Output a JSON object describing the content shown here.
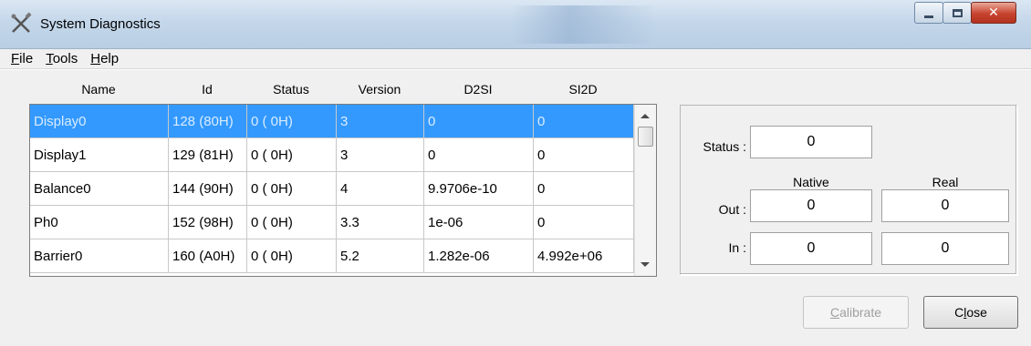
{
  "window": {
    "title": "System Diagnostics",
    "app_icon": "crossed-tools-icon",
    "controls": [
      "minimize-icon",
      "maximize-icon",
      "close-icon"
    ]
  },
  "menu": [
    {
      "pre": "",
      "u": "F",
      "post": "ile"
    },
    {
      "pre": "",
      "u": "T",
      "post": "ools"
    },
    {
      "pre": "",
      "u": "H",
      "post": "elp"
    }
  ],
  "table": {
    "columns": [
      "Name",
      "Id",
      "Status",
      "Version",
      "D2SI",
      "SI2D"
    ],
    "rows": [
      [
        "Display0",
        "128 (80H)",
        "0 ( 0H)",
        "3",
        "0",
        "0"
      ],
      [
        "Display1",
        "129 (81H)",
        "0 ( 0H)",
        "3",
        "0",
        "0"
      ],
      [
        "Balance0",
        "144 (90H)",
        "0 ( 0H)",
        "4",
        "9.9706e-10",
        "0"
      ],
      [
        "Ph0",
        "152 (98H)",
        "0 ( 0H)",
        "3.3",
        "1e-06",
        "0"
      ],
      [
        "Barrier0",
        "160 (A0H)",
        "0 ( 0H)",
        "5.2",
        "1.282e-06",
        "4.992e+06"
      ]
    ],
    "selected_row": 0
  },
  "panel": {
    "status_label": "Status :",
    "status_value": "0",
    "native_header": "Native",
    "real_header": "Real",
    "out_label": "Out :",
    "out_native": "0",
    "out_real": "0",
    "in_label": "In :",
    "in_native": "0",
    "in_real": "0"
  },
  "buttons": {
    "calibrate": {
      "u": "C",
      "post": "alibrate"
    },
    "close": {
      "pre": "C",
      "u": "l",
      "post": "ose"
    }
  },
  "colors": {
    "selection": "#3399ff",
    "titlebar": "#c4d7ea",
    "close_button": "#c7432e"
  }
}
